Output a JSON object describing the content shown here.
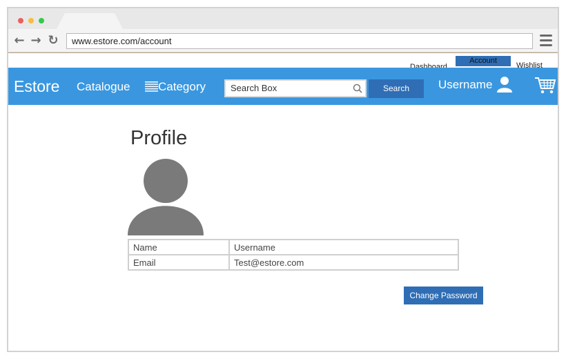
{
  "browser": {
    "url": "www.estore.com/account",
    "window_dots": [
      "red",
      "yellow",
      "green"
    ]
  },
  "top_links": {
    "dashboard": "Dashboard",
    "account": "Account",
    "wishlist": "Wishlist"
  },
  "header": {
    "brand": "Estore",
    "catalogue": "Catalogue",
    "category": "Category",
    "search_placeholder": "Search Box",
    "search_button": "Search",
    "username": "Username"
  },
  "profile": {
    "title": "Profile",
    "rows": [
      {
        "label": "Name",
        "value": "Username"
      },
      {
        "label": "Email",
        "value": "Test@estore.com"
      }
    ],
    "change_password_button": "Change Password"
  },
  "colors": {
    "header_bg": "#3a97df",
    "button_bg": "#2f6eb5",
    "avatar": "#7a7a7a"
  },
  "icons": [
    "back-icon",
    "forward-icon",
    "reload-icon",
    "menu-icon",
    "list-icon",
    "search-icon",
    "user-icon",
    "cart-icon"
  ]
}
